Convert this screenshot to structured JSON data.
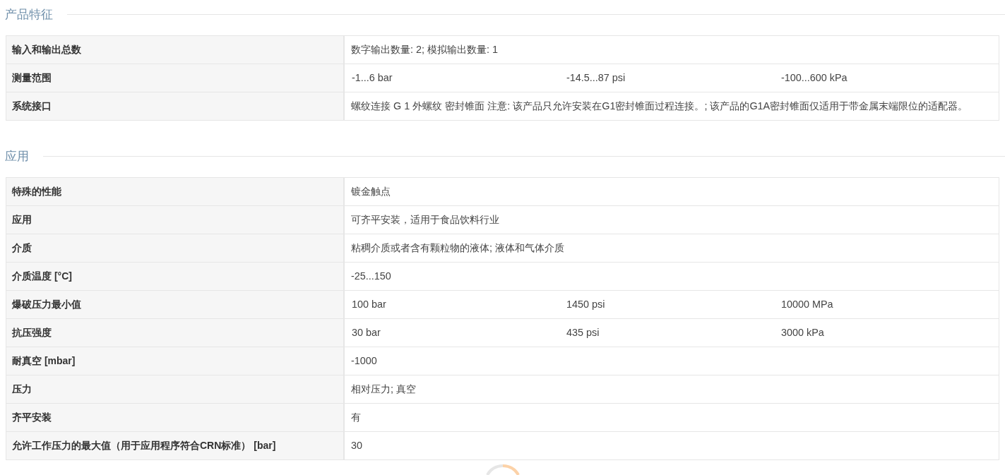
{
  "sections": [
    {
      "title": "产品特征",
      "rows": [
        {
          "label": "输入和输出总数",
          "values": [
            "数字输出数量: 2; 模拟输出数量: 1"
          ]
        },
        {
          "label": "测量范围",
          "values": [
            "-1...6 bar",
            "-14.5...87 psi",
            "-100...600 kPa"
          ]
        },
        {
          "label": "系统接口",
          "values": [
            "螺纹连接 G 1 外螺纹 密封锥面 注意: 该产品只允许安装在G1密封锥面过程连接。; 该产品的G1A密封锥面仅适用于带金属末端限位的适配器。"
          ]
        }
      ]
    },
    {
      "title": "应用",
      "rows": [
        {
          "label": "特殊的性能",
          "values": [
            "镀金触点"
          ]
        },
        {
          "label": "应用",
          "values": [
            "可齐平安装，适用于食品饮料行业"
          ]
        },
        {
          "label": "介质",
          "values": [
            "粘稠介质或者含有颗粒物的液体; 液体和气体介质"
          ]
        },
        {
          "label": "介质温度 [°C]",
          "values": [
            "-25...150"
          ]
        },
        {
          "label": "爆破压力最小值",
          "values": [
            "100 bar",
            "1450 psi",
            "10000 MPa"
          ]
        },
        {
          "label": "抗压强度",
          "values": [
            "30 bar",
            "435 psi",
            "3000 kPa"
          ]
        },
        {
          "label": "耐真空 [mbar]",
          "values": [
            "-1000"
          ]
        },
        {
          "label": "压力",
          "values": [
            "相对压力; 真空"
          ]
        },
        {
          "label": "齐平安装",
          "values": [
            "有"
          ]
        },
        {
          "label": "允许工作压力的最大值（用于应用程序符合CRN标准） [bar]",
          "values": [
            "30"
          ]
        }
      ]
    }
  ]
}
